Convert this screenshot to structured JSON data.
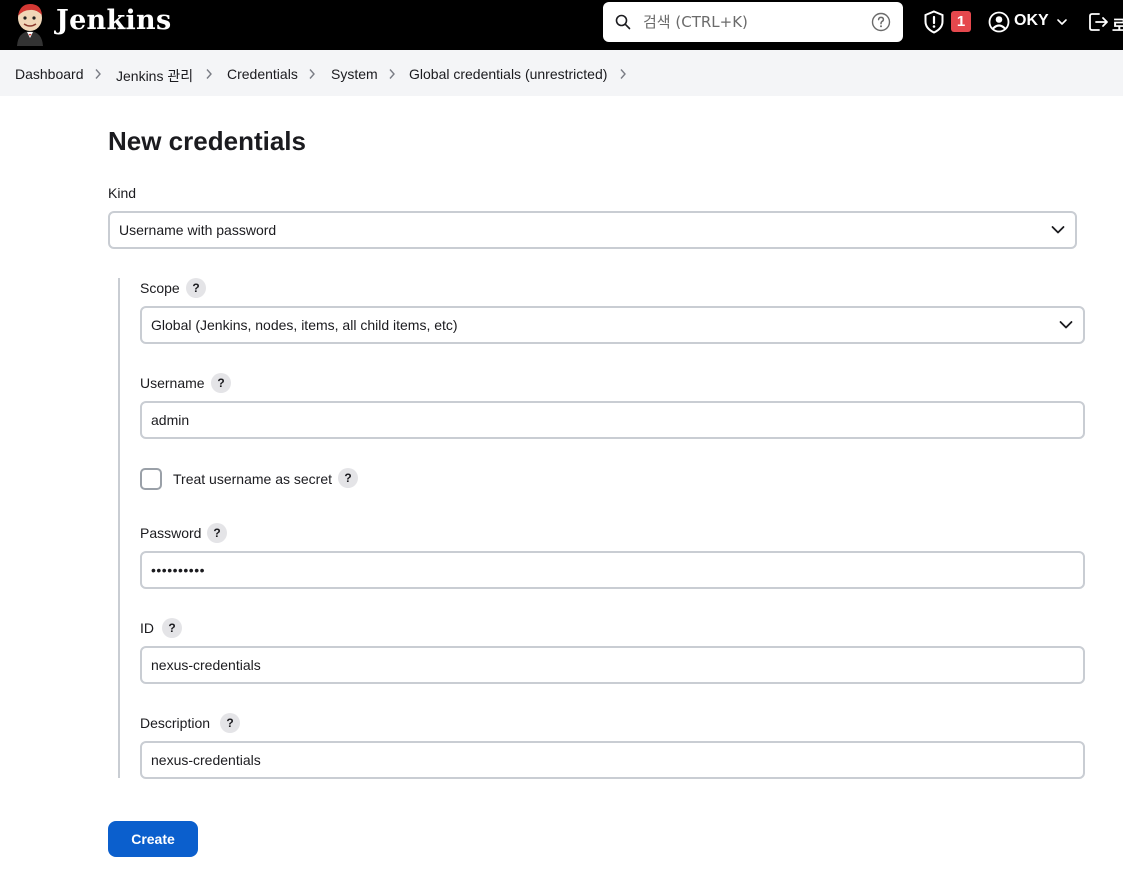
{
  "header": {
    "brand": "Jenkins",
    "search_placeholder": "검색 (CTRL+K)",
    "security_badge": "1",
    "user_name": "OKY",
    "logout_label": "로"
  },
  "breadcrumb": [
    "Dashboard",
    "Jenkins 관리",
    "Credentials",
    "System",
    "Global credentials (unrestricted)"
  ],
  "form": {
    "title": "New credentials",
    "kind_label": "Kind",
    "kind_value": "Username with password",
    "scope_label": "Scope",
    "scope_value": "Global (Jenkins, nodes, items, all child items, etc)",
    "username_label": "Username",
    "username_value": "admin",
    "treat_secret_label": "Treat username as secret",
    "password_label": "Password",
    "password_value": "••••••••••",
    "id_label": "ID",
    "id_value": "nexus-credentials",
    "description_label": "Description",
    "description_value": "nexus-credentials",
    "help_glyph": "?",
    "create_label": "Create"
  }
}
